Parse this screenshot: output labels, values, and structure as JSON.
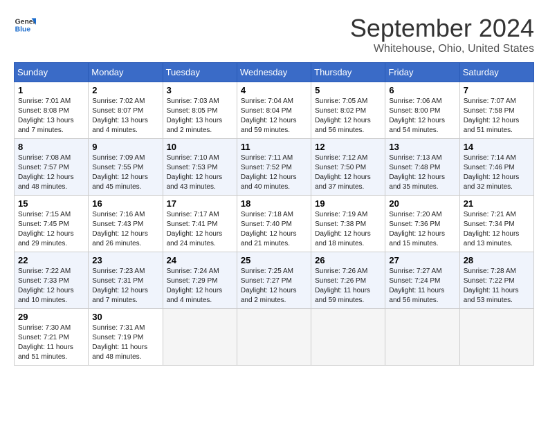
{
  "header": {
    "logo_line1": "General",
    "logo_line2": "Blue",
    "month": "September 2024",
    "location": "Whitehouse, Ohio, United States"
  },
  "columns": [
    "Sunday",
    "Monday",
    "Tuesday",
    "Wednesday",
    "Thursday",
    "Friday",
    "Saturday"
  ],
  "weeks": [
    [
      {
        "day": "1",
        "info": "Sunrise: 7:01 AM\nSunset: 8:08 PM\nDaylight: 13 hours and 7 minutes."
      },
      {
        "day": "2",
        "info": "Sunrise: 7:02 AM\nSunset: 8:07 PM\nDaylight: 13 hours and 4 minutes."
      },
      {
        "day": "3",
        "info": "Sunrise: 7:03 AM\nSunset: 8:05 PM\nDaylight: 13 hours and 2 minutes."
      },
      {
        "day": "4",
        "info": "Sunrise: 7:04 AM\nSunset: 8:04 PM\nDaylight: 12 hours and 59 minutes."
      },
      {
        "day": "5",
        "info": "Sunrise: 7:05 AM\nSunset: 8:02 PM\nDaylight: 12 hours and 56 minutes."
      },
      {
        "day": "6",
        "info": "Sunrise: 7:06 AM\nSunset: 8:00 PM\nDaylight: 12 hours and 54 minutes."
      },
      {
        "day": "7",
        "info": "Sunrise: 7:07 AM\nSunset: 7:58 PM\nDaylight: 12 hours and 51 minutes."
      }
    ],
    [
      {
        "day": "8",
        "info": "Sunrise: 7:08 AM\nSunset: 7:57 PM\nDaylight: 12 hours and 48 minutes."
      },
      {
        "day": "9",
        "info": "Sunrise: 7:09 AM\nSunset: 7:55 PM\nDaylight: 12 hours and 45 minutes."
      },
      {
        "day": "10",
        "info": "Sunrise: 7:10 AM\nSunset: 7:53 PM\nDaylight: 12 hours and 43 minutes."
      },
      {
        "day": "11",
        "info": "Sunrise: 7:11 AM\nSunset: 7:52 PM\nDaylight: 12 hours and 40 minutes."
      },
      {
        "day": "12",
        "info": "Sunrise: 7:12 AM\nSunset: 7:50 PM\nDaylight: 12 hours and 37 minutes."
      },
      {
        "day": "13",
        "info": "Sunrise: 7:13 AM\nSunset: 7:48 PM\nDaylight: 12 hours and 35 minutes."
      },
      {
        "day": "14",
        "info": "Sunrise: 7:14 AM\nSunset: 7:46 PM\nDaylight: 12 hours and 32 minutes."
      }
    ],
    [
      {
        "day": "15",
        "info": "Sunrise: 7:15 AM\nSunset: 7:45 PM\nDaylight: 12 hours and 29 minutes."
      },
      {
        "day": "16",
        "info": "Sunrise: 7:16 AM\nSunset: 7:43 PM\nDaylight: 12 hours and 26 minutes."
      },
      {
        "day": "17",
        "info": "Sunrise: 7:17 AM\nSunset: 7:41 PM\nDaylight: 12 hours and 24 minutes."
      },
      {
        "day": "18",
        "info": "Sunrise: 7:18 AM\nSunset: 7:40 PM\nDaylight: 12 hours and 21 minutes."
      },
      {
        "day": "19",
        "info": "Sunrise: 7:19 AM\nSunset: 7:38 PM\nDaylight: 12 hours and 18 minutes."
      },
      {
        "day": "20",
        "info": "Sunrise: 7:20 AM\nSunset: 7:36 PM\nDaylight: 12 hours and 15 minutes."
      },
      {
        "day": "21",
        "info": "Sunrise: 7:21 AM\nSunset: 7:34 PM\nDaylight: 12 hours and 13 minutes."
      }
    ],
    [
      {
        "day": "22",
        "info": "Sunrise: 7:22 AM\nSunset: 7:33 PM\nDaylight: 12 hours and 10 minutes."
      },
      {
        "day": "23",
        "info": "Sunrise: 7:23 AM\nSunset: 7:31 PM\nDaylight: 12 hours and 7 minutes."
      },
      {
        "day": "24",
        "info": "Sunrise: 7:24 AM\nSunset: 7:29 PM\nDaylight: 12 hours and 4 minutes."
      },
      {
        "day": "25",
        "info": "Sunrise: 7:25 AM\nSunset: 7:27 PM\nDaylight: 12 hours and 2 minutes."
      },
      {
        "day": "26",
        "info": "Sunrise: 7:26 AM\nSunset: 7:26 PM\nDaylight: 11 hours and 59 minutes."
      },
      {
        "day": "27",
        "info": "Sunrise: 7:27 AM\nSunset: 7:24 PM\nDaylight: 11 hours and 56 minutes."
      },
      {
        "day": "28",
        "info": "Sunrise: 7:28 AM\nSunset: 7:22 PM\nDaylight: 11 hours and 53 minutes."
      }
    ],
    [
      {
        "day": "29",
        "info": "Sunrise: 7:30 AM\nSunset: 7:21 PM\nDaylight: 11 hours and 51 minutes."
      },
      {
        "day": "30",
        "info": "Sunrise: 7:31 AM\nSunset: 7:19 PM\nDaylight: 11 hours and 48 minutes."
      },
      {
        "day": "",
        "info": ""
      },
      {
        "day": "",
        "info": ""
      },
      {
        "day": "",
        "info": ""
      },
      {
        "day": "",
        "info": ""
      },
      {
        "day": "",
        "info": ""
      }
    ]
  ]
}
